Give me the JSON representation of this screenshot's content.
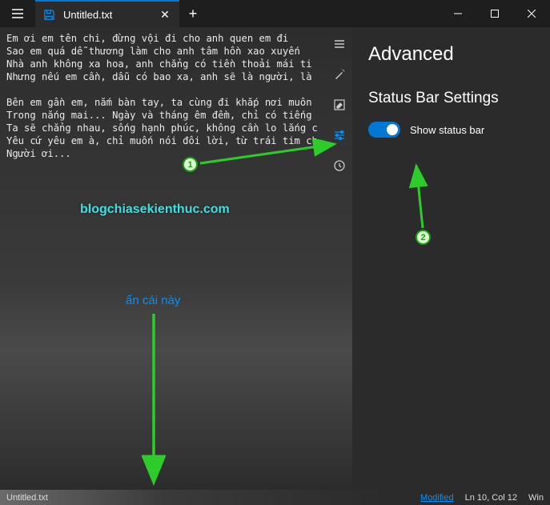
{
  "titlebar": {
    "tab_title": "Untitled.txt",
    "close_glyph": "✕",
    "newtab_glyph": "+"
  },
  "editor": {
    "content": "Em ơi em tên chi, đừng vội đi cho anh quen em đi\nSao em quá dễ thương làm cho anh tâm hồn xao xuyến\nNhà anh không xa hoa, anh chẳng có tiền thoải mái ti\nNhưng nếu em cần, dẫu có bao xa, anh sẽ là người, là\n\nBên em gần em, nắm bàn tay, ta cùng đi khắp nơi muôn\nTrong nắng mai... Ngày và tháng êm đềm, chỉ có tiếng\nTa sẽ chẳng nhau, sống hạnh phúc, không cần lo lắng c\nYêu cứ yêu em à, chỉ muốn nói đôi lời, từ trái tim ch\nNgười ơi..."
  },
  "panel": {
    "title": "Advanced",
    "section": "Status Bar Settings",
    "toggle_label": "Show status bar"
  },
  "statusbar": {
    "filename": "Untitled.txt",
    "modified": "Modified",
    "cursor": "Ln 10, Col 12",
    "encoding": "Win"
  },
  "annotations": {
    "marker1": "1",
    "marker2": "2",
    "watermark": "blogchiasekienthuc.com",
    "hide_label": "ẩn cái này"
  }
}
